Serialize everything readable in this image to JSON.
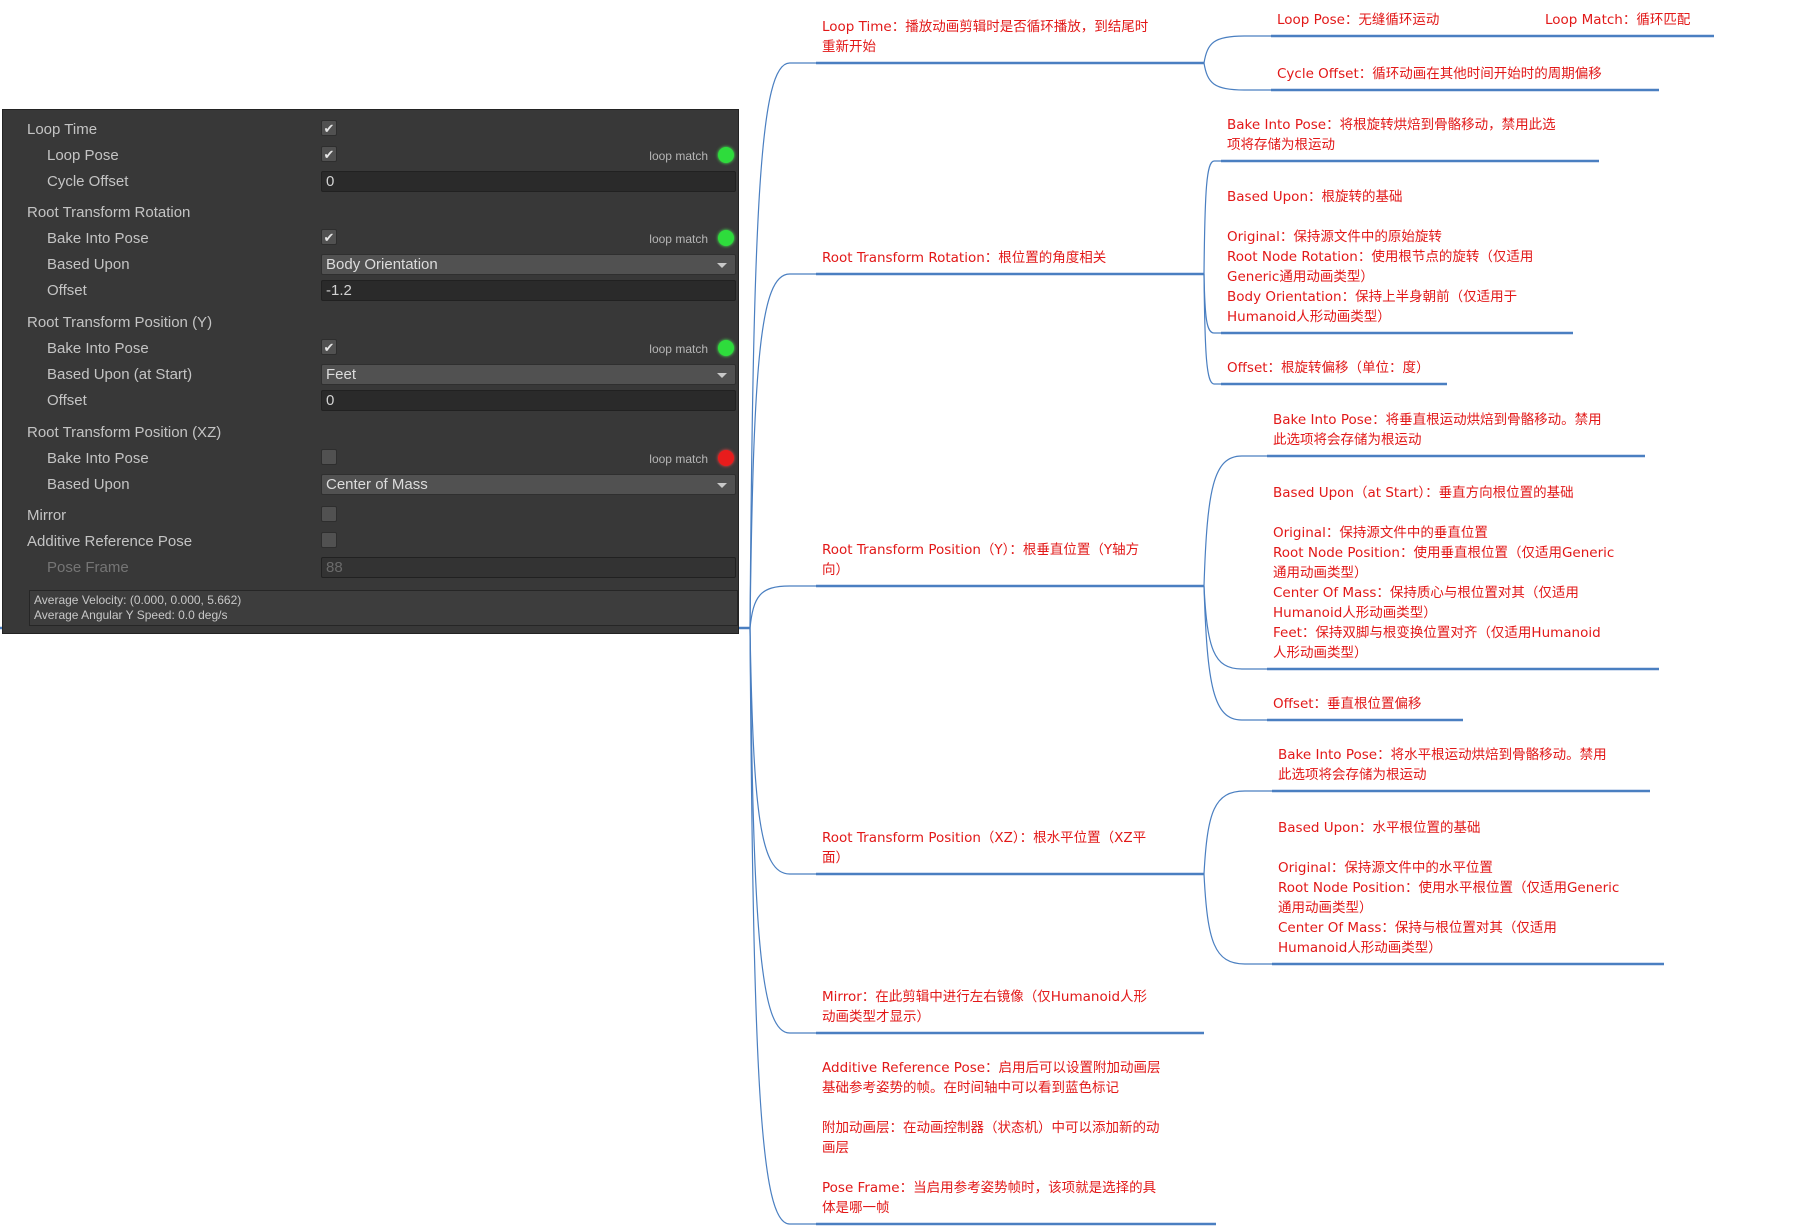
{
  "inspector": {
    "rows": [
      {
        "label": "Loop Time",
        "indent": 0,
        "control": "check",
        "checked": true
      },
      {
        "label": "Loop Pose",
        "indent": 1,
        "control": "check",
        "checked": true,
        "loop_match": "loop match",
        "status": "green"
      },
      {
        "label": "Cycle Offset",
        "indent": 1,
        "control": "field",
        "value": "0"
      },
      {
        "label": "Root Transform Rotation",
        "indent": 0,
        "control": "none"
      },
      {
        "label": "Bake Into Pose",
        "indent": 1,
        "control": "check",
        "checked": true,
        "loop_match": "loop match",
        "status": "green"
      },
      {
        "label": "Based Upon",
        "indent": 1,
        "control": "dropdown",
        "value": "Body Orientation"
      },
      {
        "label": "Offset",
        "indent": 1,
        "control": "field",
        "value": "-1.2"
      },
      {
        "label": "Root Transform Position (Y)",
        "indent": 0,
        "control": "none"
      },
      {
        "label": "Bake Into Pose",
        "indent": 1,
        "control": "check",
        "checked": true,
        "loop_match": "loop match",
        "status": "green"
      },
      {
        "label": "Based Upon (at Start)",
        "indent": 1,
        "control": "dropdown",
        "value": "Feet"
      },
      {
        "label": "Offset",
        "indent": 1,
        "control": "field",
        "value": "0"
      },
      {
        "label": "Root Transform Position (XZ)",
        "indent": 0,
        "control": "none"
      },
      {
        "label": "Bake Into Pose",
        "indent": 1,
        "control": "check",
        "checked": false,
        "loop_match": "loop match",
        "status": "red"
      },
      {
        "label": "Based Upon",
        "indent": 1,
        "control": "dropdown",
        "value": "Center of Mass"
      },
      {
        "label": "Mirror",
        "indent": 0,
        "control": "check",
        "checked": false
      },
      {
        "label": "Additive Reference Pose",
        "indent": 0,
        "control": "check",
        "checked": false
      },
      {
        "label": "Pose Frame",
        "indent": 1,
        "control": "field",
        "value": "88",
        "disabled": true
      }
    ],
    "summary": [
      "Average Velocity: (0.000, 0.000, 5.662)",
      "Average Angular Y Speed: 0.0 deg/s"
    ]
  },
  "mindmap": {
    "line_color": "#4a7fc1",
    "text_color": "#e21818",
    "branches": [
      {
        "id": "loop-time",
        "lines": [
          "Loop Time：播放动画剪辑时是否循环播放，到结尾时",
          "重新开始"
        ],
        "children": [
          {
            "id": "loop-pose",
            "lines": [
              "Loop Pose：无缝循环运动"
            ],
            "child": {
              "id": "loop-match",
              "lines": [
                "Loop Match：循环匹配"
              ]
            }
          },
          {
            "id": "cycle-offset",
            "lines": [
              "Cycle Offset：循环动画在其他时间开始时的周期偏移"
            ]
          }
        ]
      },
      {
        "id": "root-rotation",
        "lines": [
          "Root Transform Rotation：根位置的角度相关"
        ],
        "children": [
          {
            "id": "rot-bake",
            "lines": [
              "Bake Into Pose：将根旋转烘焙到骨骼移动，禁用此选",
              "项将存储为根运动"
            ]
          },
          {
            "id": "rot-based",
            "lines": [
              "Based Upon：根旋转的基础",
              "",
              "Original：保持源文件中的原始旋转",
              "Root Node Rotation：使用根节点的旋转（仅适用",
              "Generic通用动画类型）",
              "Body Orientation：保持上半身朝前（仅适用于",
              "Humanoid人形动画类型）"
            ]
          },
          {
            "id": "rot-offset",
            "lines": [
              "Offset：根旋转偏移（单位：度）"
            ]
          }
        ]
      },
      {
        "id": "root-pos-y",
        "lines": [
          "Root Transform Position（Y）：根垂直位置（Y轴方",
          "向）"
        ],
        "children": [
          {
            "id": "y-bake",
            "lines": [
              "Bake Into Pose：将垂直根运动烘焙到骨骼移动。禁用",
              "此选项将会存储为根运动"
            ]
          },
          {
            "id": "y-based",
            "lines": [
              "Based Upon（at Start）：垂直方向根位置的基础",
              "",
              "Original：保持源文件中的垂直位置",
              "Root Node Position：使用垂直根位置（仅适用Generic",
              "通用动画类型）",
              "Center Of Mass：保持质心与根位置对其（仅适用",
              "Humanoid人形动画类型）",
              "Feet：保持双脚与根变换位置对齐（仅适用Humanoid",
              "人形动画类型）"
            ]
          },
          {
            "id": "y-offset",
            "lines": [
              "Offset：垂直根位置偏移"
            ]
          }
        ]
      },
      {
        "id": "root-pos-xz",
        "lines": [
          "Root Transform Position（XZ）：根水平位置（XZ平",
          "面）"
        ],
        "children": [
          {
            "id": "xz-bake",
            "lines": [
              "Bake Into Pose：将水平根运动烘焙到骨骼移动。禁用",
              "此选项将会存储为根运动"
            ]
          },
          {
            "id": "xz-based",
            "lines": [
              "Based Upon：水平根位置的基础",
              "",
              "Original：保持源文件中的水平位置",
              "Root Node Position：使用水平根位置（仅适用Generic",
              "通用动画类型）",
              "Center Of Mass：保持与根位置对其（仅适用",
              "Humanoid人形动画类型）"
            ]
          }
        ]
      },
      {
        "id": "mirror",
        "lines": [
          "Mirror：在此剪辑中进行左右镜像（仅Humanoid人形",
          "动画类型才显示）"
        ],
        "children": []
      },
      {
        "id": "additive",
        "lines": [
          "Additive Reference Pose：启用后可以设置附加动画层",
          "基础参考姿势的帧。在时间轴中可以看到蓝色标记",
          "",
          "附加动画层：在动画控制器（状态机）中可以添加新的动",
          "画层",
          "",
          "Pose Frame：当启用参考姿势帧时，该项就是选择的具",
          "体是哪一帧"
        ],
        "children": []
      }
    ]
  }
}
